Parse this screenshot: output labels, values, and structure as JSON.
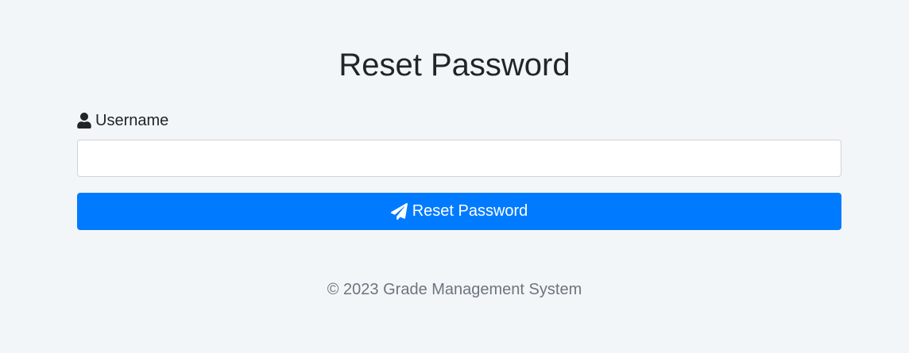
{
  "page": {
    "title": "Reset Password"
  },
  "form": {
    "username_label": "Username",
    "username_icon": "user-icon",
    "username_value": "",
    "username_placeholder": "",
    "submit_label": "Reset Password",
    "submit_icon": "paper-plane-icon"
  },
  "footer": {
    "text": "© 2023 Grade Management System"
  },
  "colors": {
    "background": "#f3f6f9",
    "primary": "#007bff",
    "text": "#212529",
    "muted": "#6c757d",
    "input_border": "#ced4da"
  }
}
